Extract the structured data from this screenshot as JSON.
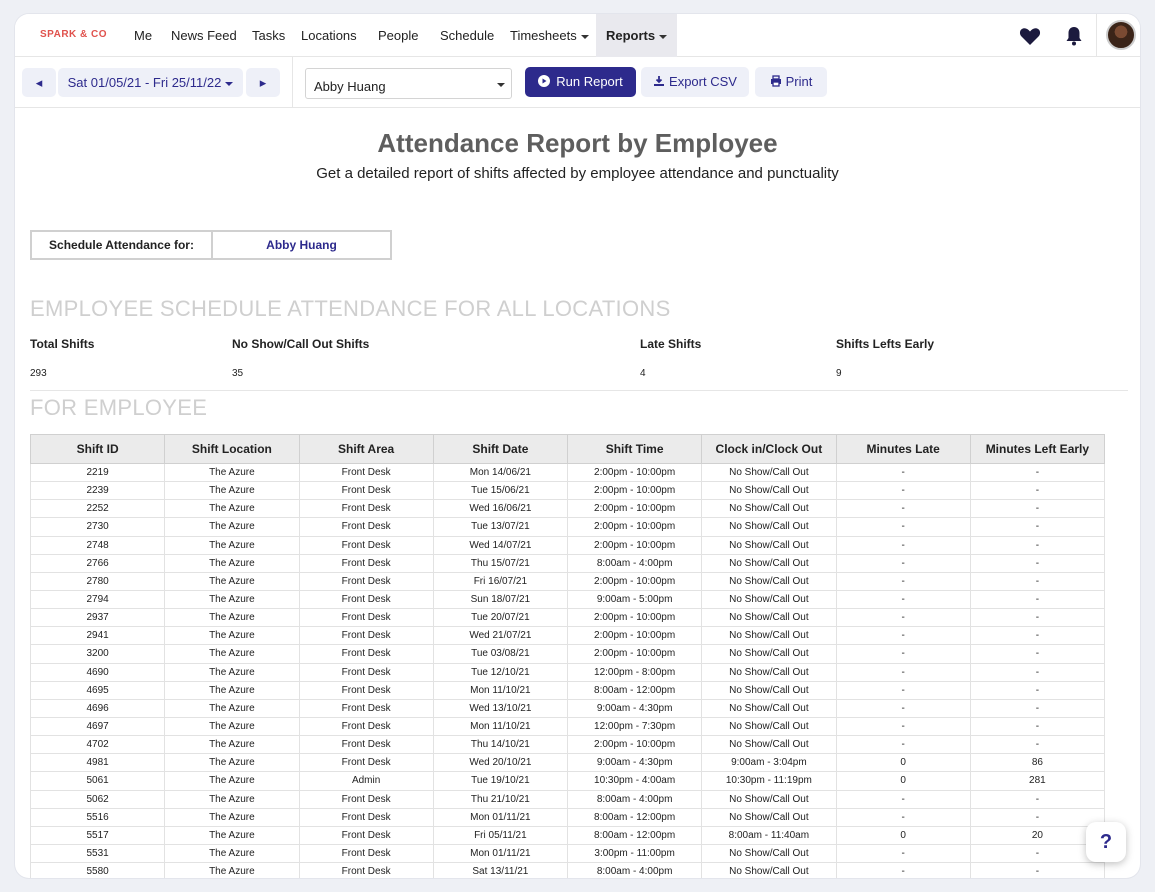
{
  "nav": {
    "brand": "SPARK & CO",
    "items": [
      "Me",
      "News Feed",
      "Tasks",
      "Locations",
      "People",
      "Schedule",
      "Timesheets",
      "Reports"
    ]
  },
  "toolbar": {
    "prev": "◂",
    "date_range": "Sat 01/05/21 - Fri 25/11/22",
    "next": "▸",
    "employee_select": "Abby Huang",
    "run_report": "Run Report",
    "export_csv": "Export CSV",
    "print": "Print"
  },
  "report": {
    "title": "Attendance Report by Employee",
    "subtitle": "Get a detailed report of shifts affected by employee attendance and punctuality",
    "schedule_label": "Schedule Attendance for:",
    "schedule_value": "Abby Huang",
    "section_all": "EMPLOYEE SCHEDULE ATTENDANCE FOR ALL LOCATIONS",
    "section_employee": "FOR EMPLOYEE",
    "stats": [
      {
        "label": "Total Shifts",
        "value": "293"
      },
      {
        "label": "No Show/Call Out Shifts",
        "value": "35"
      },
      {
        "label": "Late Shifts",
        "value": "4"
      },
      {
        "label": "Shifts Lefts Early",
        "value": "9"
      }
    ]
  },
  "table": {
    "headers": [
      "Shift ID",
      "Shift Location",
      "Shift Area",
      "Shift Date",
      "Shift Time",
      "Clock in/Clock Out",
      "Minutes Late",
      "Minutes Left Early"
    ],
    "rows": [
      [
        "2219",
        "The Azure",
        "Front Desk",
        "Mon 14/06/21",
        "2:00pm - 10:00pm",
        "No Show/Call Out",
        "-",
        "-"
      ],
      [
        "2239",
        "The Azure",
        "Front Desk",
        "Tue 15/06/21",
        "2:00pm - 10:00pm",
        "No Show/Call Out",
        "-",
        "-"
      ],
      [
        "2252",
        "The Azure",
        "Front Desk",
        "Wed 16/06/21",
        "2:00pm - 10:00pm",
        "No Show/Call Out",
        "-",
        "-"
      ],
      [
        "2730",
        "The Azure",
        "Front Desk",
        "Tue 13/07/21",
        "2:00pm - 10:00pm",
        "No Show/Call Out",
        "-",
        "-"
      ],
      [
        "2748",
        "The Azure",
        "Front Desk",
        "Wed 14/07/21",
        "2:00pm - 10:00pm",
        "No Show/Call Out",
        "-",
        "-"
      ],
      [
        "2766",
        "The Azure",
        "Front Desk",
        "Thu 15/07/21",
        "8:00am - 4:00pm",
        "No Show/Call Out",
        "-",
        "-"
      ],
      [
        "2780",
        "The Azure",
        "Front Desk",
        "Fri 16/07/21",
        "2:00pm - 10:00pm",
        "No Show/Call Out",
        "-",
        "-"
      ],
      [
        "2794",
        "The Azure",
        "Front Desk",
        "Sun 18/07/21",
        "9:00am - 5:00pm",
        "No Show/Call Out",
        "-",
        "-"
      ],
      [
        "2937",
        "The Azure",
        "Front Desk",
        "Tue 20/07/21",
        "2:00pm - 10:00pm",
        "No Show/Call Out",
        "-",
        "-"
      ],
      [
        "2941",
        "The Azure",
        "Front Desk",
        "Wed 21/07/21",
        "2:00pm - 10:00pm",
        "No Show/Call Out",
        "-",
        "-"
      ],
      [
        "3200",
        "The Azure",
        "Front Desk",
        "Tue 03/08/21",
        "2:00pm - 10:00pm",
        "No Show/Call Out",
        "-",
        "-"
      ],
      [
        "4690",
        "The Azure",
        "Front Desk",
        "Tue 12/10/21",
        "12:00pm - 8:00pm",
        "No Show/Call Out",
        "-",
        "-"
      ],
      [
        "4695",
        "The Azure",
        "Front Desk",
        "Mon 11/10/21",
        "8:00am - 12:00pm",
        "No Show/Call Out",
        "-",
        "-"
      ],
      [
        "4696",
        "The Azure",
        "Front Desk",
        "Wed 13/10/21",
        "9:00am - 4:30pm",
        "No Show/Call Out",
        "-",
        "-"
      ],
      [
        "4697",
        "The Azure",
        "Front Desk",
        "Mon 11/10/21",
        "12:00pm - 7:30pm",
        "No Show/Call Out",
        "-",
        "-"
      ],
      [
        "4702",
        "The Azure",
        "Front Desk",
        "Thu 14/10/21",
        "2:00pm - 10:00pm",
        "No Show/Call Out",
        "-",
        "-"
      ],
      [
        "4981",
        "The Azure",
        "Front Desk",
        "Wed 20/10/21",
        "9:00am - 4:30pm",
        "9:00am - 3:04pm",
        "0",
        "86"
      ],
      [
        "5061",
        "The Azure",
        "Admin",
        "Tue 19/10/21",
        "10:30pm - 4:00am",
        "10:30pm - 11:19pm",
        "0",
        "281"
      ],
      [
        "5062",
        "The Azure",
        "Front Desk",
        "Thu 21/10/21",
        "8:00am - 4:00pm",
        "No Show/Call Out",
        "-",
        "-"
      ],
      [
        "5516",
        "The Azure",
        "Front Desk",
        "Mon 01/11/21",
        "8:00am - 12:00pm",
        "No Show/Call Out",
        "-",
        "-"
      ],
      [
        "5517",
        "The Azure",
        "Front Desk",
        "Fri 05/11/21",
        "8:00am - 12:00pm",
        "8:00am - 11:40am",
        "0",
        "20"
      ],
      [
        "5531",
        "The Azure",
        "Front Desk",
        "Mon 01/11/21",
        "3:00pm - 11:00pm",
        "No Show/Call Out",
        "-",
        "-"
      ],
      [
        "5580",
        "The Azure",
        "Front Desk",
        "Sat 13/11/21",
        "8:00am - 4:00pm",
        "No Show/Call Out",
        "-",
        "-"
      ]
    ]
  },
  "help": {
    "label": "?"
  },
  "colors": {
    "brand": "#e0524d",
    "primary": "#2d2a8c",
    "heading_grey": "#cfcfcf"
  }
}
